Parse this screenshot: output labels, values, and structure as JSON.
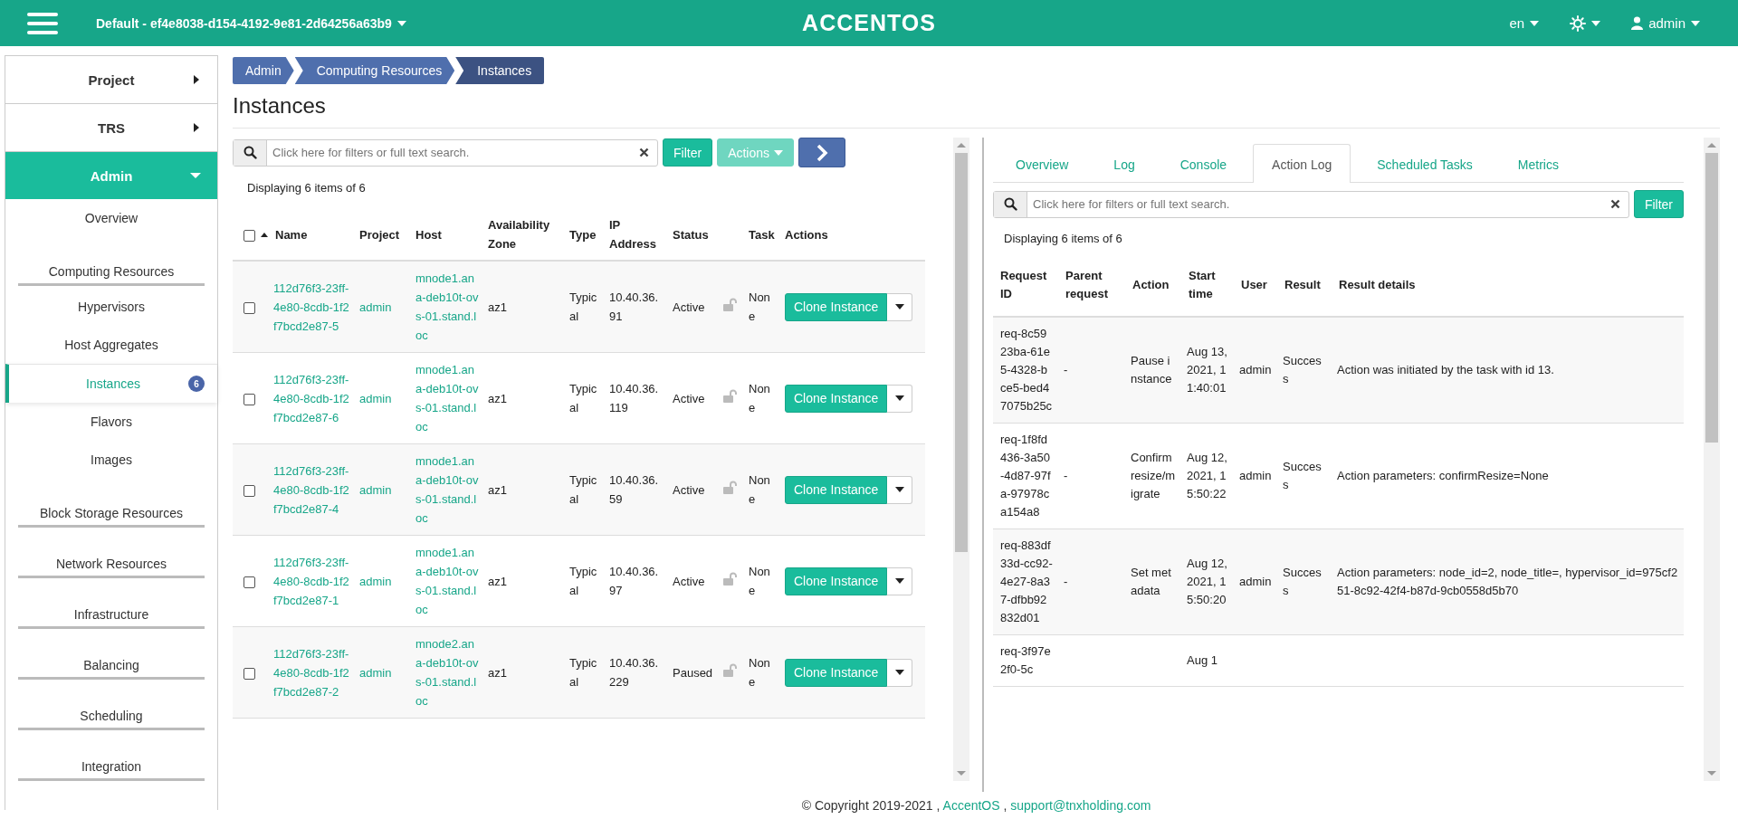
{
  "topbar": {
    "project": "Default - ef4e8038-d154-4192-9e81-2d64256a63b9",
    "logo": "ACCENTOS",
    "language": "en",
    "user": "admin"
  },
  "sidebar": {
    "items": [
      {
        "kind": "section",
        "label": "Project",
        "expanded": false
      },
      {
        "kind": "section",
        "label": "TRS",
        "expanded": false
      },
      {
        "kind": "section",
        "label": "Admin",
        "expanded": true,
        "children": [
          {
            "kind": "link",
            "label": "Overview",
            "selected": false
          },
          {
            "kind": "group",
            "label": "Computing Resources"
          },
          {
            "kind": "link",
            "label": "Hypervisors",
            "selected": false
          },
          {
            "kind": "link",
            "label": "Host Aggregates",
            "selected": false
          },
          {
            "kind": "link",
            "label": "Instances",
            "selected": true,
            "badge": "6"
          },
          {
            "kind": "link",
            "label": "Flavors",
            "selected": false
          },
          {
            "kind": "link",
            "label": "Images",
            "selected": false
          },
          {
            "kind": "group",
            "label": "Block Storage Resources"
          },
          {
            "kind": "group",
            "label": "Network Resources"
          },
          {
            "kind": "group",
            "label": "Infrastructure"
          },
          {
            "kind": "group",
            "label": "Balancing"
          },
          {
            "kind": "group",
            "label": "Scheduling"
          },
          {
            "kind": "group",
            "label": "Integration"
          }
        ]
      }
    ]
  },
  "breadcrumb": [
    "Admin",
    "Computing Resources",
    "Instances"
  ],
  "page_title": "Instances",
  "instances": {
    "search": {
      "placeholder": "Click here for filters or full text search."
    },
    "filter_button": "Filter",
    "actions_button": {
      "label": "Actions",
      "disabled": true
    },
    "count": "Displaying 6 items of 6",
    "select_all": {
      "checked": false
    },
    "columns": [
      {
        "label": "Name",
        "sorted": true
      },
      {
        "label": "Project"
      },
      {
        "label": "Host"
      },
      {
        "label": "Availability Zone"
      },
      {
        "label": "Type"
      },
      {
        "label": "IP Address"
      },
      {
        "label": "Status"
      },
      {
        "label": "Task"
      },
      {
        "label": "Actions"
      }
    ],
    "rows": [
      {
        "checked": false,
        "name": "112d76f3-23ff-4e80-8cdb-1f2f7bcd2e87-5",
        "project": "admin",
        "host": "mnode1.ana-deb10t-ovs-01.stand.loc",
        "zone": "az1",
        "type": "Typical",
        "ip": "10.40.36.91",
        "status": "Active",
        "locked": false,
        "task": "None",
        "action": "Clone Instance"
      },
      {
        "checked": false,
        "name": "112d76f3-23ff-4e80-8cdb-1f2f7bcd2e87-6",
        "project": "admin",
        "host": "mnode1.ana-deb10t-ovs-01.stand.loc",
        "zone": "az1",
        "type": "Typical",
        "ip": "10.40.36.119",
        "status": "Active",
        "locked": false,
        "task": "None",
        "action": "Clone Instance"
      },
      {
        "checked": false,
        "name": "112d76f3-23ff-4e80-8cdb-1f2f7bcd2e87-4",
        "project": "admin",
        "host": "mnode1.ana-deb10t-ovs-01.stand.loc",
        "zone": "az1",
        "type": "Typical",
        "ip": "10.40.36.59",
        "status": "Active",
        "locked": false,
        "task": "None",
        "action": "Clone Instance"
      },
      {
        "checked": false,
        "name": "112d76f3-23ff-4e80-8cdb-1f2f7bcd2e87-1",
        "project": "admin",
        "host": "mnode1.ana-deb10t-ovs-01.stand.loc",
        "zone": "az1",
        "type": "Typical",
        "ip": "10.40.36.97",
        "status": "Active",
        "locked": false,
        "task": "None",
        "action": "Clone Instance"
      },
      {
        "checked": false,
        "name": "112d76f3-23ff-4e80-8cdb-1f2f7bcd2e87-2",
        "project": "admin",
        "host": "mnode2.ana-deb10t-ovs-01.stand.loc",
        "zone": "az1",
        "type": "Typical",
        "ip": "10.40.36.229",
        "status": "Paused",
        "locked": false,
        "task": "None",
        "action": "Clone Instance"
      }
    ]
  },
  "detail": {
    "tabs": [
      {
        "label": "Overview",
        "selected": false
      },
      {
        "label": "Log",
        "selected": false
      },
      {
        "label": "Console",
        "selected": false
      },
      {
        "label": "Action Log",
        "selected": true
      },
      {
        "label": "Scheduled Tasks",
        "selected": false
      },
      {
        "label": "Metrics",
        "selected": false
      }
    ],
    "search": {
      "placeholder": "Click here for filters or full text search."
    },
    "filter_button": "Filter",
    "count": "Displaying 6 items of 6",
    "columns": [
      "Request ID",
      "Parent request",
      "Action",
      "Start time",
      "User",
      "Result",
      "Result details"
    ],
    "rows": [
      {
        "request_id": "req-8c5923ba-61e5-4328-bce5-bed47075b25c",
        "parent_request": "-",
        "action": "Pause instance",
        "start_time": "Aug 13, 2021, 11:40:01",
        "user": "admin",
        "result": "Success",
        "details": "Action was initiated by the task with id 13."
      },
      {
        "request_id": "req-1f8fd436-3a50-4d87-97fa-97978ca154a8",
        "parent_request": "-",
        "action": "Confirm resize/migrate",
        "start_time": "Aug 12, 2021, 15:50:22",
        "user": "admin",
        "result": "Success",
        "details": "Action parameters: confirmResize=None"
      },
      {
        "request_id": "req-883df33d-cc92-4e27-8a37-dfbb92832d01",
        "parent_request": "-",
        "action": "Set metadata",
        "start_time": "Aug 12, 2021, 15:50:20",
        "user": "admin",
        "result": "Success",
        "details": "Action parameters: node_id=2, node_title=, hypervisor_id=975cf251-8c92-42f4-b87d-9cb0558d5b70"
      },
      {
        "request_id": "req-3f97e2f0-5c",
        "start_time": "Aug 1"
      }
    ]
  },
  "footer": [
    {
      "kind": "text",
      "text": "© Copyright 2019-2021 ,"
    },
    {
      "kind": "link",
      "text": "AccentOS"
    },
    {
      "kind": "text",
      "text": ","
    },
    {
      "kind": "link",
      "text": "support@tnxholding.com"
    }
  ]
}
